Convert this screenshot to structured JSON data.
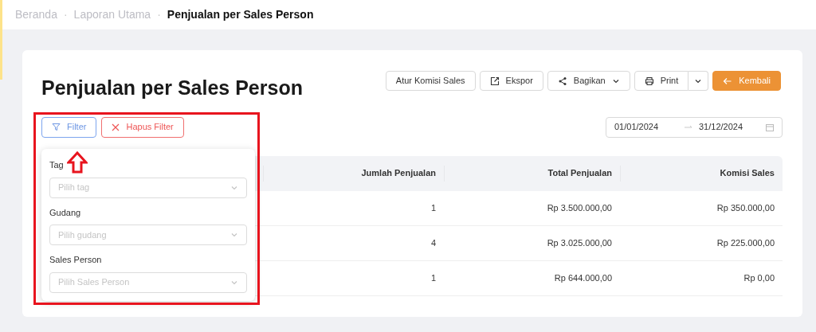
{
  "breadcrumb": [
    {
      "label": "Beranda",
      "selected": false
    },
    {
      "label": "Laporan Utama",
      "selected": false
    },
    {
      "label": "Penjualan per Sales Person",
      "selected": true
    }
  ],
  "separator": "·",
  "title": "Penjualan per Sales Person",
  "actions": [
    {
      "kind": "plain",
      "label": "Atur Komisi Sales"
    },
    {
      "kind": "export",
      "label": "Ekspor"
    },
    {
      "kind": "share",
      "label": "Bagikan"
    },
    {
      "kind": "print",
      "label": "Print"
    },
    {
      "kind": "primary",
      "label": "Kembali"
    }
  ],
  "filter_button": {
    "label": "Filter",
    "selected": true
  },
  "clear_filter_button": {
    "label": "Hapus Filter"
  },
  "date_range": {
    "start": "01/01/2024",
    "end": "31/12/2024"
  },
  "filter_panel": {
    "fields": [
      {
        "label": "Tag",
        "placeholder": "Pilih tag"
      },
      {
        "label": "Gudang",
        "placeholder": "Pilih gudang"
      },
      {
        "label": "Sales Person",
        "placeholder": "Pilih Sales Person"
      }
    ]
  },
  "table": {
    "columns": [
      "Jumlah Penjualan",
      "Total Penjualan",
      "Komisi Sales"
    ],
    "rows": [
      [
        "1",
        "Rp 3.500.000,00",
        "Rp 350.000,00"
      ],
      [
        "4",
        "Rp 3.025.000,00",
        "Rp 225.000,00"
      ],
      [
        "1",
        "Rp 644.000,00",
        "Rp 0,00"
      ]
    ]
  }
}
